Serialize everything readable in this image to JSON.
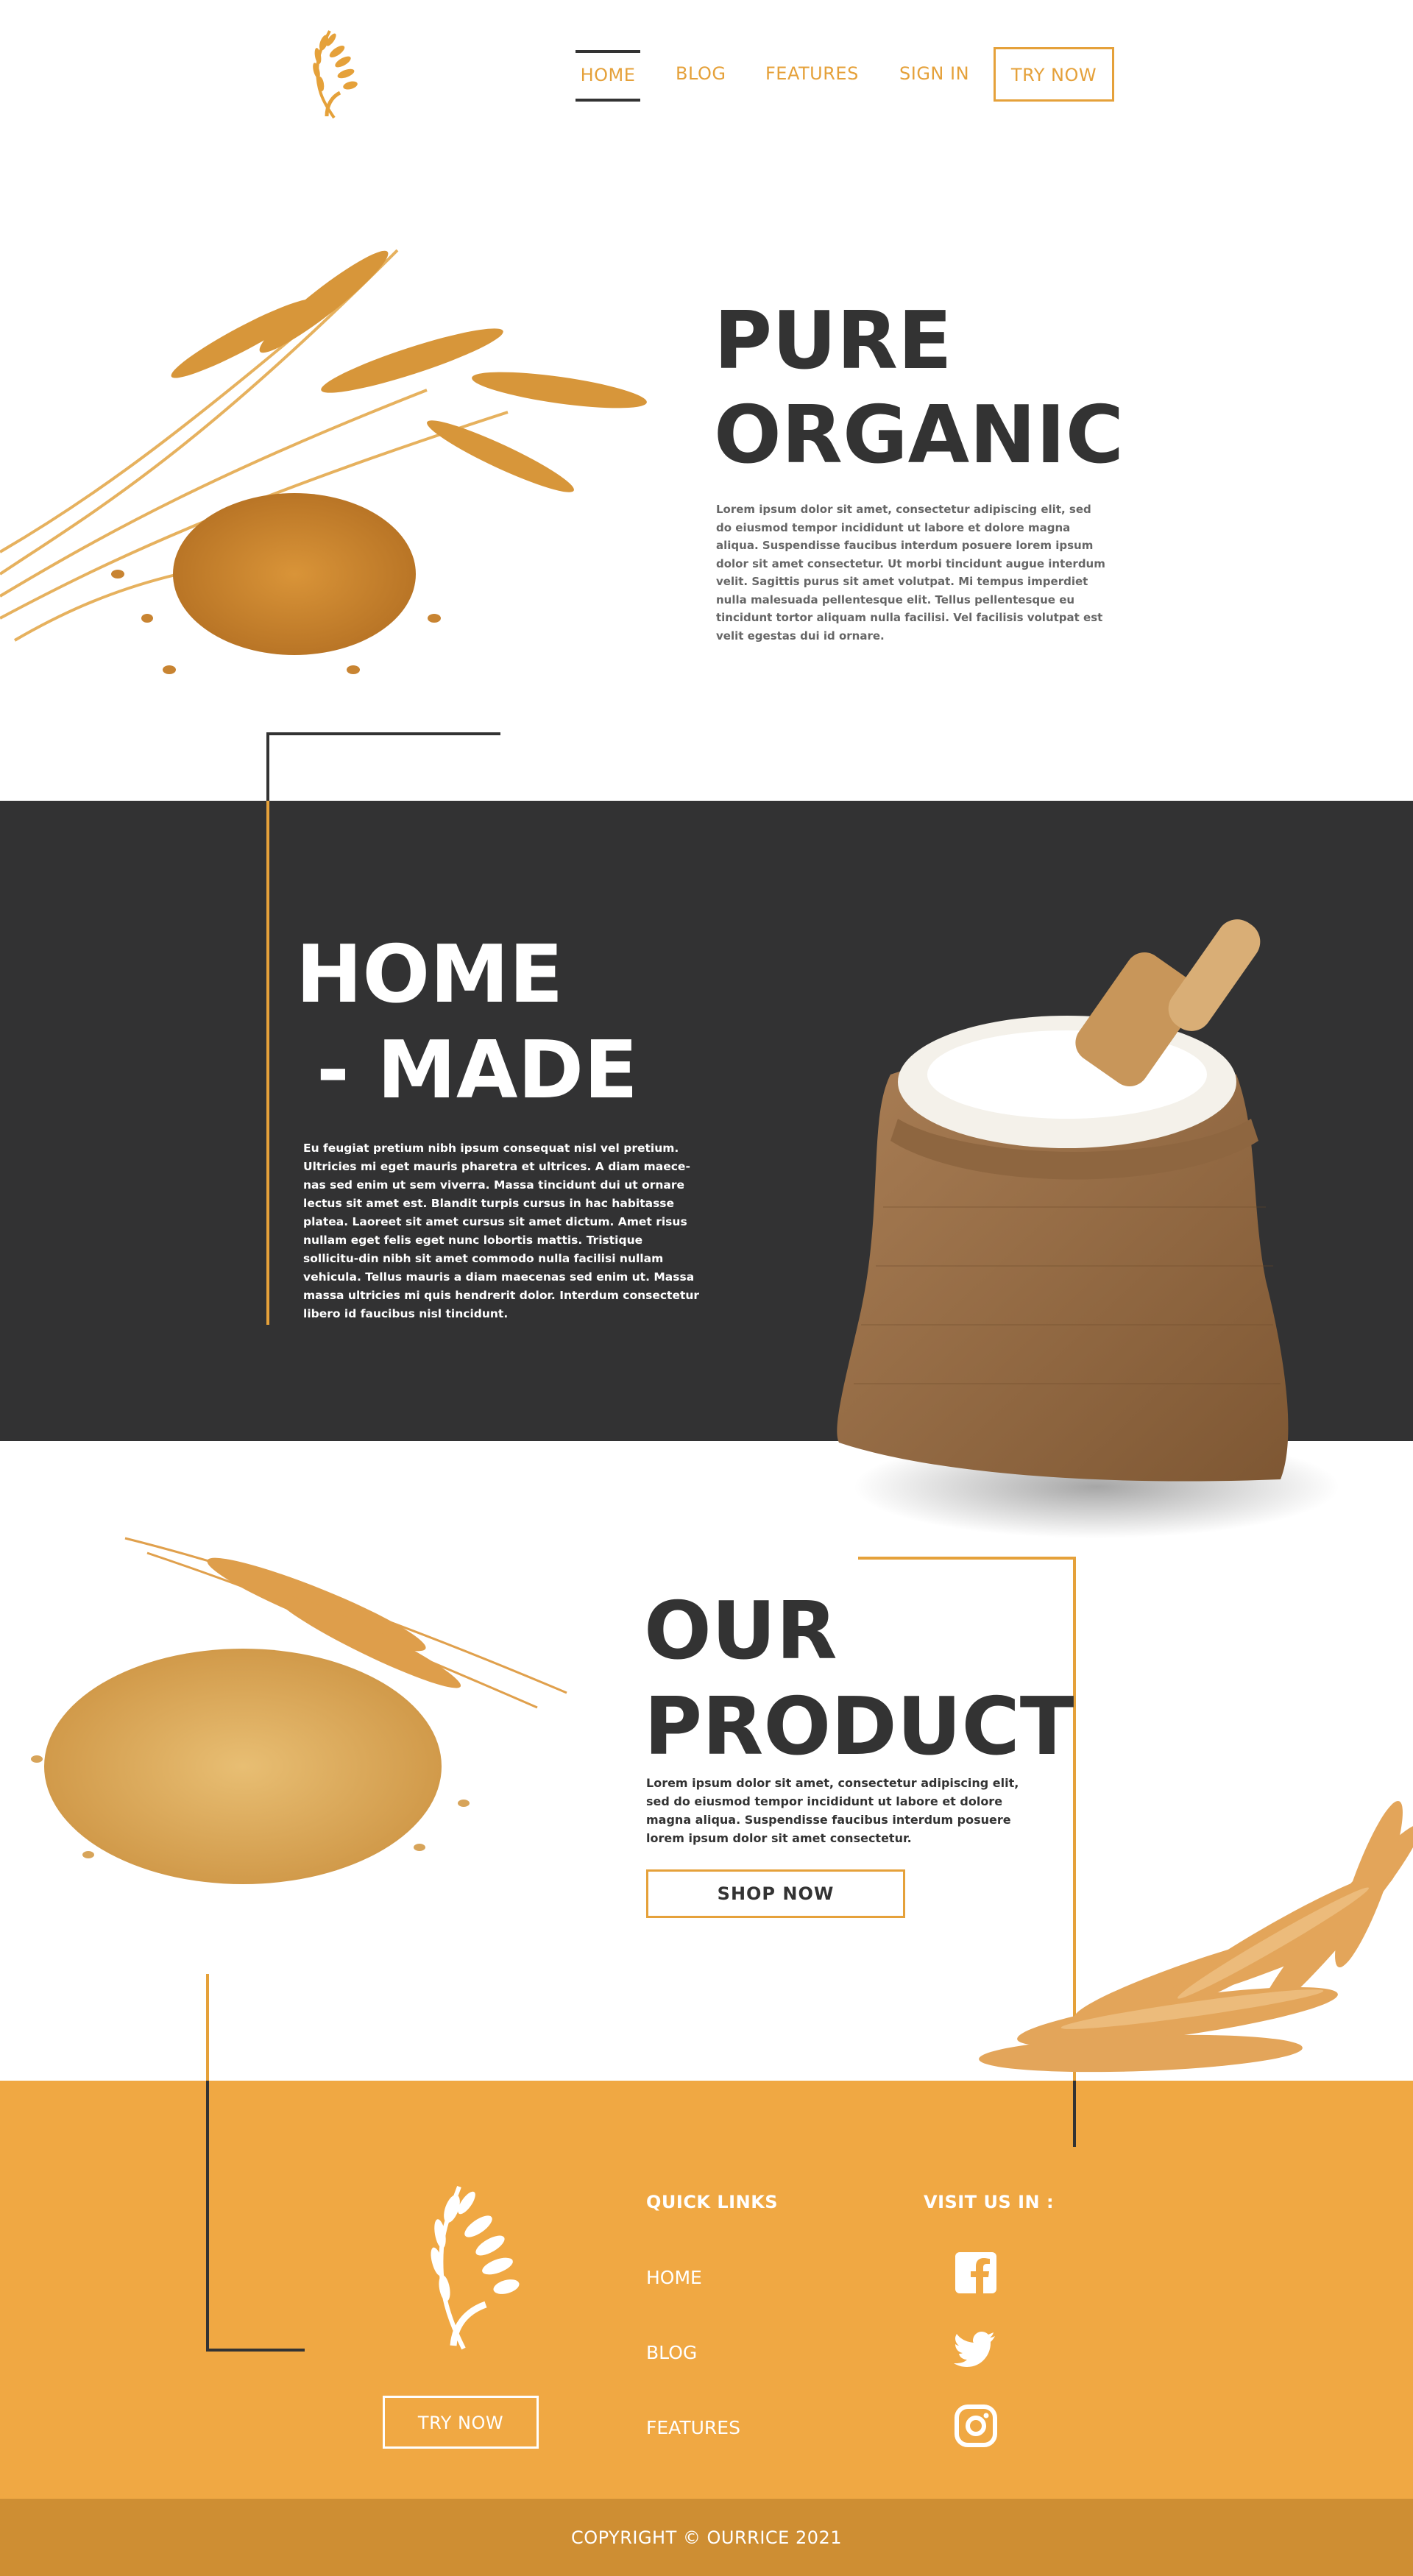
{
  "brand": {
    "accent": "#F0A843",
    "accent_text": "#E5A13A",
    "dark": "#323233",
    "copyright_bar": "#CE8E33"
  },
  "nav": {
    "logo_icon": "wheat-logo-icon",
    "items": [
      {
        "label": "HOME",
        "active": true
      },
      {
        "label": "BLOG"
      },
      {
        "label": "FEATURES"
      },
      {
        "label": "SIGN IN"
      }
    ],
    "try_label": "TRY NOW"
  },
  "hero": {
    "title_line1": "PURE",
    "title_line2": "ORGANIC",
    "body": "Lorem ipsum dolor sit amet, consectetur adipiscing elit, sed do eiusmod tempor incididunt ut labore et dolore magna aliqua. Suspendisse faucibus interdum posuere lorem ipsum dolor sit amet consectetur. Ut morbi tincidunt augue interdum velit. Sagittis purus sit amet volutpat. Mi tempus imperdiet nulla malesuada pellentesque elit. Tellus pellentesque eu tincidunt tortor aliquam nulla facilisi. Vel facilisis volutpat est velit egestas dui id ornare.",
    "image": "wheat-stalks-grains-image"
  },
  "homemade": {
    "title_line1": "HOME",
    "title_line2": "- MADE",
    "body": "Eu feugiat pretium nibh ipsum consequat nisl vel pretium. Ultricies mi eget mauris pharetra et ultrices. A diam maece-nas sed enim ut sem viverra. Massa tincidunt dui ut ornare lectus sit amet est. Blandit turpis cursus in hac habitasse platea. Laoreet sit amet cursus sit amet dictum. Amet risus nullam eget felis eget nunc lobortis mattis. Tristique sollicitu-din nibh sit amet commodo nulla facilisi nullam vehicula. Tellus mauris a diam maecenas sed enim ut. Massa massa ultricies mi quis hendrerit dolor. Interdum consectetur libero id faucibus nisl tincidunt.",
    "image": "rice-sack-scoop-image"
  },
  "product": {
    "title_line1": "OUR",
    "title_line2": "PRODUCT",
    "body": "Lorem ipsum dolor sit amet, consectetur adipiscing elit, sed do eiusmod tempor incididunt ut labore et dolore magna aliqua. Suspendisse faucibus interdum posuere lorem ipsum dolor sit amet consectetur.",
    "button": "SHOP NOW",
    "image_left": "barley-grains-image",
    "image_right": "wheat-ears-image"
  },
  "footer": {
    "logo_icon": "wheat-logo-icon",
    "try_label": "TRY NOW",
    "quick_links_title": "QUICK LINKS",
    "quick_links": [
      "HOME",
      "BLOG",
      "FEATURES"
    ],
    "visit_title": "VISIT US IN :",
    "social": [
      "facebook-icon",
      "twitter-icon",
      "instagram-icon"
    ],
    "copyright": "COPYRIGHT © OURRICE 2021"
  }
}
